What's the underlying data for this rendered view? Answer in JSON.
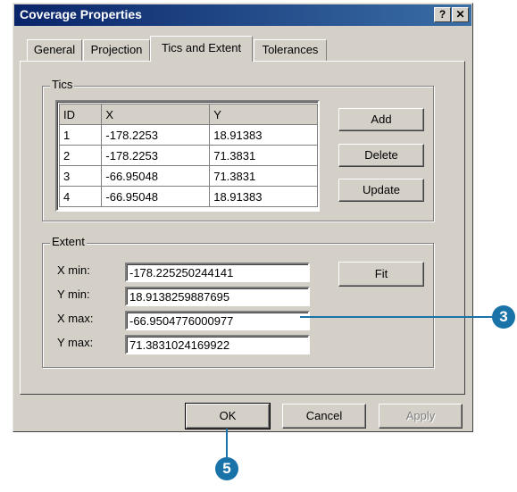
{
  "window": {
    "title": "Coverage Properties",
    "help_label": "?",
    "close_label": "✕"
  },
  "tabs": [
    {
      "label": "General"
    },
    {
      "label": "Projection"
    },
    {
      "label": "Tics and Extent",
      "active": true
    },
    {
      "label": "Tolerances"
    }
  ],
  "tics": {
    "group_label": "Tics",
    "columns": [
      "ID",
      "X",
      "Y"
    ],
    "rows": [
      [
        "1",
        "-178.2253",
        "18.91383"
      ],
      [
        "2",
        "-178.2253",
        "71.3831"
      ],
      [
        "3",
        "-66.95048",
        "71.3831"
      ],
      [
        "4",
        "-66.95048",
        "18.91383"
      ]
    ],
    "add_label": "Add",
    "delete_label": "Delete",
    "update_label": "Update"
  },
  "extent": {
    "group_label": "Extent",
    "xmin_label": "X min:",
    "xmin_value": "-178.225250244141",
    "ymin_label": "Y min:",
    "ymin_value": "18.9138259887695",
    "xmax_label": "X max:",
    "xmax_value": "-66.9504776000977",
    "ymax_label": "Y max:",
    "ymax_value": "71.3831024169922",
    "fit_label": "Fit"
  },
  "footer": {
    "ok_label": "OK",
    "cancel_label": "Cancel",
    "apply_label": "Apply"
  },
  "callouts": {
    "step3": "3",
    "step5": "5"
  },
  "colors": {
    "titlebar": "#0a246a",
    "callout": "#1a73a8",
    "dialog": "#d4d0c8"
  }
}
